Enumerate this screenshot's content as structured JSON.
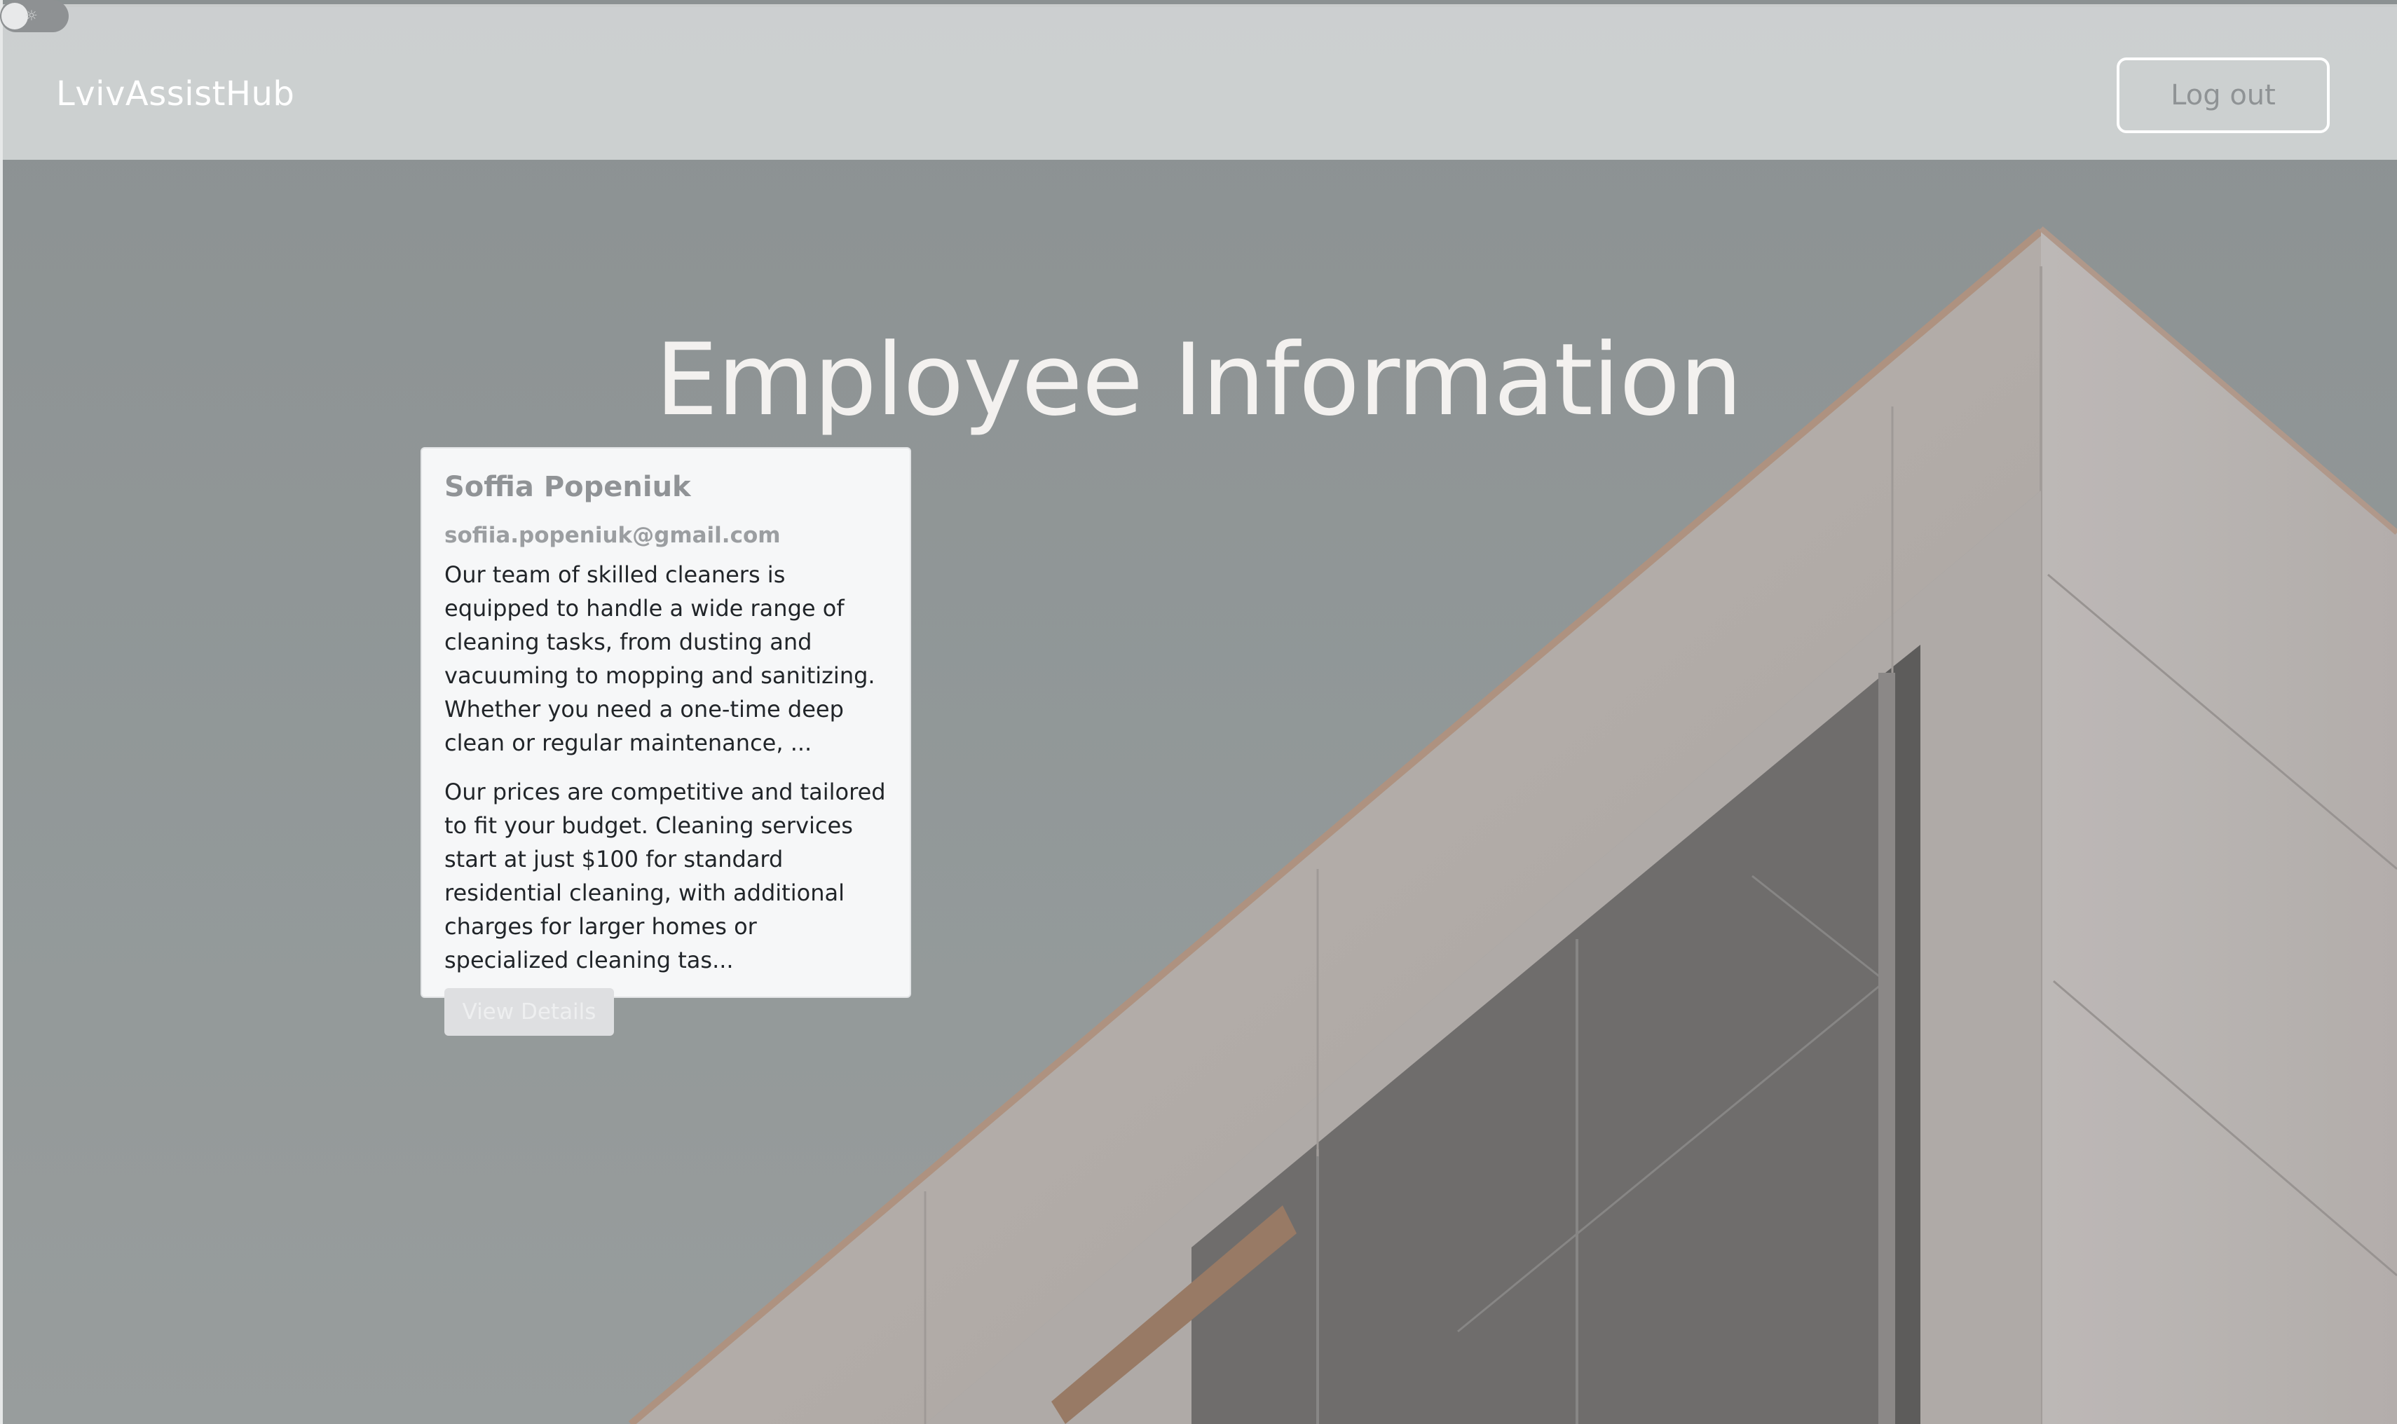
{
  "header": {
    "brand": "LvivAssistHub",
    "logout_label": "Log out"
  },
  "theme_toggle": {
    "icon": "sun-icon"
  },
  "main": {
    "title": "Employee Information"
  },
  "employees": [
    {
      "name": "Soffia Popeniuk",
      "email": "sofiia.popeniuk@gmail.com",
      "description": "Our team of skilled cleaners is equipped to handle a wide range of cleaning tasks, from dusting and vacuuming to mopping and sanitizing. Whether you need a one-time deep clean or regular maintenance, ...",
      "pricing": "Our prices are competitive and tailored to fit your budget. Cleaning services start at just $100 for standard residential cleaning, with additional charges for larger homes or specialized cleaning tas...",
      "button_label": "View Details"
    }
  ],
  "colors": {
    "background": "#949a9b",
    "card": "#f6f7f8",
    "navbar": "#d6dada"
  }
}
